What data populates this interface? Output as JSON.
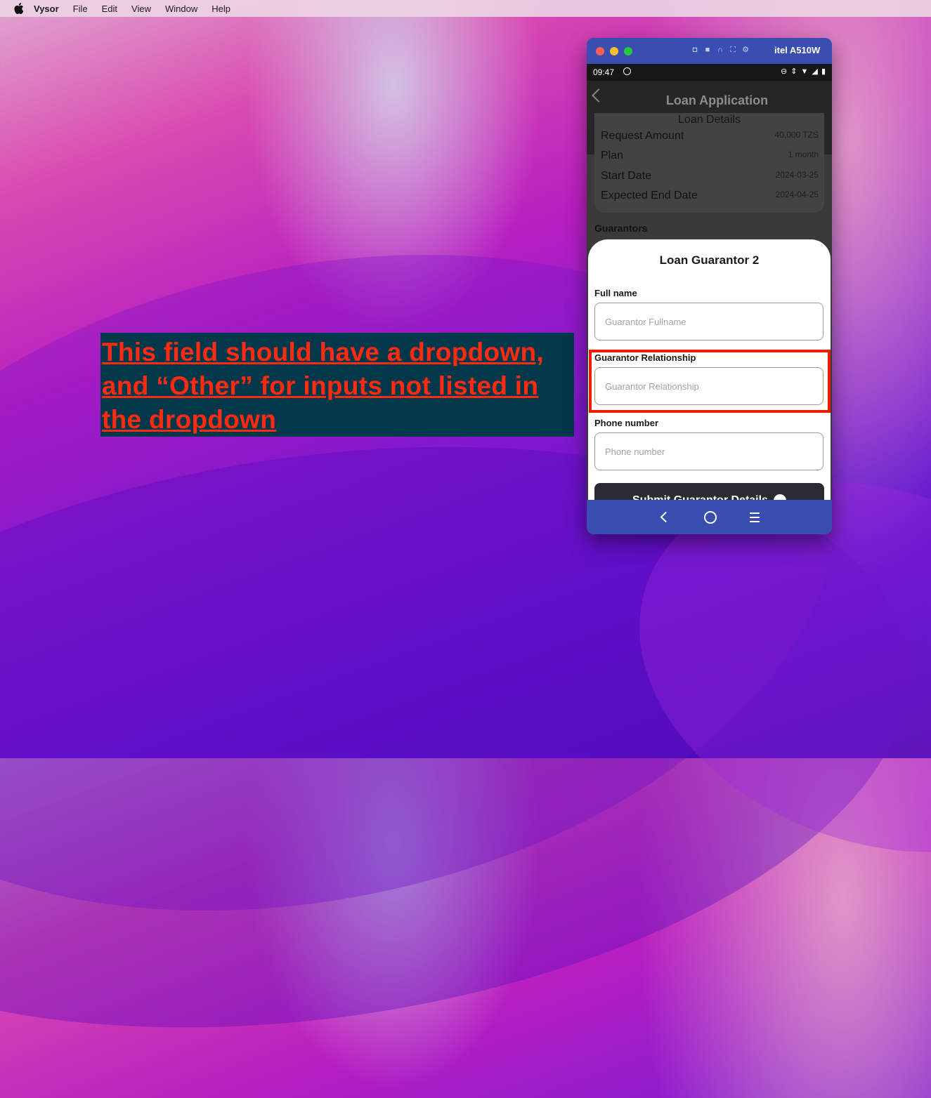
{
  "menubar": {
    "app": "Vysor",
    "items": [
      "File",
      "Edit",
      "View",
      "Window",
      "Help"
    ]
  },
  "annotation": {
    "text": "This field should have a dropdown, and “Other” for inputs not listed in the dropdown",
    "color": "#ff2a12"
  },
  "window": {
    "device_name": "itel A510W",
    "toolbar_icons": [
      "camera-icon",
      "video-icon",
      "headphones-icon",
      "fullscreen-icon",
      "gear-icon"
    ]
  },
  "status_bar": {
    "time": "09:47",
    "indicators": "⊖ ⇕ ▼ ◢ ▮"
  },
  "app": {
    "title": "Loan Application",
    "loan_details": {
      "title": "Loan Details",
      "rows": [
        {
          "label": "Request Amount",
          "value": "40,000 TZS"
        },
        {
          "label": "Plan",
          "value": "1 month"
        },
        {
          "label": "Start Date",
          "value": "2024-03-25"
        },
        {
          "label": "Expected End Date",
          "value": "2024-04-25"
        }
      ]
    },
    "guarantors_heading": "Guarantors"
  },
  "sheet": {
    "title": "Loan Guarantor 2",
    "full_name": {
      "label": "Full name",
      "value": "",
      "placeholder": "Guarantor Fullname"
    },
    "relationship": {
      "label": "Guarantor Relationship",
      "value": "",
      "placeholder": "Guarantor Relationship"
    },
    "phone": {
      "label": "Phone number",
      "value": "",
      "placeholder": "Phone number"
    },
    "submit_label": "Submit Guarantor Details"
  }
}
